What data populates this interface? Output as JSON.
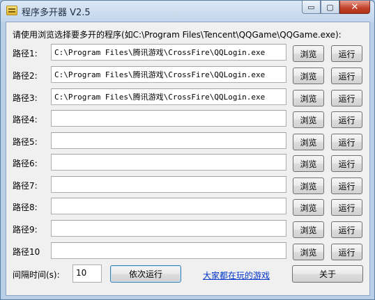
{
  "window": {
    "title": "程序多开器 V2.5",
    "minimize_glyph": "▭",
    "maximize_glyph": "▢",
    "close_glyph": "✕"
  },
  "hint": "请使用浏览选择要多开的程序(如C:\\Program Files\\Tencent\\QQGame\\QQGame.exe):",
  "rows": [
    {
      "label": "路径1:",
      "path": "C:\\Program Files\\腾讯游戏\\CrossFire\\QQLogin.exe",
      "browse": "浏览",
      "run": "运行"
    },
    {
      "label": "路径2:",
      "path": "C:\\Program Files\\腾讯游戏\\CrossFire\\QQLogin.exe",
      "browse": "浏览",
      "run": "运行"
    },
    {
      "label": "路径3:",
      "path": "C:\\Program Files\\腾讯游戏\\CrossFire\\QQLogin.exe",
      "browse": "浏览",
      "run": "运行"
    },
    {
      "label": "路径4:",
      "path": "",
      "browse": "浏览",
      "run": "运行"
    },
    {
      "label": "路径5:",
      "path": "",
      "browse": "浏览",
      "run": "运行"
    },
    {
      "label": "路径6:",
      "path": "",
      "browse": "浏览",
      "run": "运行"
    },
    {
      "label": "路径7:",
      "path": "",
      "browse": "浏览",
      "run": "运行"
    },
    {
      "label": "路径8:",
      "path": "",
      "browse": "浏览",
      "run": "运行"
    },
    {
      "label": "路径9:",
      "path": "",
      "browse": "浏览",
      "run": "运行"
    },
    {
      "label": "路径10",
      "path": "",
      "browse": "浏览",
      "run": "运行"
    }
  ],
  "footer": {
    "interval_label": "间隔时间(s):",
    "interval_value": "10",
    "run_sequential": "依次运行",
    "link": "大家都在玩的游戏",
    "about": "关于"
  },
  "colors": {
    "link": "#0033cc",
    "close_button": "#c2402a"
  },
  "icons": {
    "app": "app-icon"
  }
}
